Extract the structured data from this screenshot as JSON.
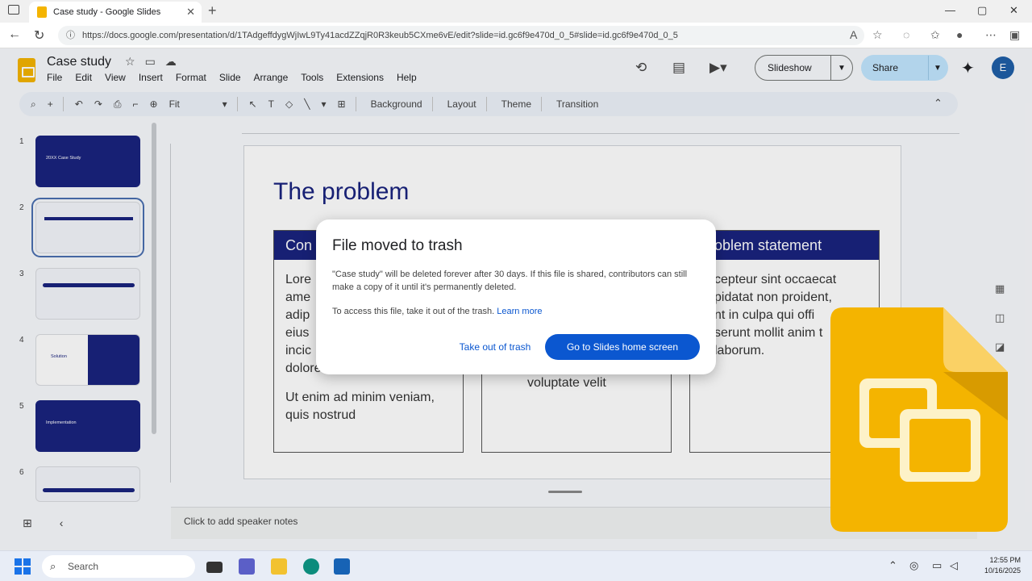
{
  "browser": {
    "tab_title": "Case study - Google Slides",
    "url": "https://docs.google.com/presentation/d/1TAdgeffdygWjIwL9Ty41acdZZqjR0R3keub5CXme6vE/edit?slide=id.gc6f9e470d_0_5#slide=id.gc6f9e470d_0_5",
    "new_tab": "+",
    "close": "✕"
  },
  "app": {
    "doc_title": "Case study",
    "menu": [
      "File",
      "Edit",
      "View",
      "Insert",
      "Format",
      "Slide",
      "Arrange",
      "Tools",
      "Extensions",
      "Help"
    ],
    "slideshow_label": "Slideshow",
    "share_label": "Share",
    "avatar_letter": "E",
    "toolbar": {
      "zoom": "Fit",
      "background": "Background",
      "layout": "Layout",
      "theme": "Theme",
      "transition": "Transition"
    }
  },
  "filmstrip": {
    "slides": [
      {
        "num": "1",
        "title": "20XX Case Study"
      },
      {
        "num": "2",
        "title": ""
      },
      {
        "num": "3",
        "title": ""
      },
      {
        "num": "4",
        "title": "Solution"
      },
      {
        "num": "5",
        "title": "Implementation"
      },
      {
        "num": "6",
        "title": ""
      }
    ]
  },
  "slide": {
    "title": "The problem",
    "columns": [
      {
        "header": "Con",
        "body1": "Lore ame adip eius incic dolore",
        "body2": "Ut enim ad minim veniam, quis nostrud"
      },
      {
        "header": "",
        "body1": "voluptate velit",
        "body2": ""
      },
      {
        "header": "oblem statement",
        "body1": "cepteur sint occaecat pidatat non proident, nt in culpa qui offi serunt mollit anim t laborum.",
        "body2": ""
      }
    ]
  },
  "notes_placeholder": "Click to add speaker notes",
  "dialog": {
    "title": "File moved to trash",
    "body": "\"Case study\" will be deleted forever after 30 days. If this file is shared, contributors can still make a copy of it until it's permanently deleted.",
    "body2": "To access this file, take it out of the trash.",
    "learn_more": "Learn more",
    "btn_secondary": "Take out of trash",
    "btn_primary": "Go to Slides home screen"
  },
  "taskbar": {
    "search_placeholder": "Search",
    "time": "12:55 PM",
    "date": "10/16/2025"
  },
  "colors": {
    "slides_yellow": "#f4b400",
    "navy": "#1a237e",
    "primary_blue": "#0b57d0",
    "share_bg": "#c2e7ff"
  }
}
